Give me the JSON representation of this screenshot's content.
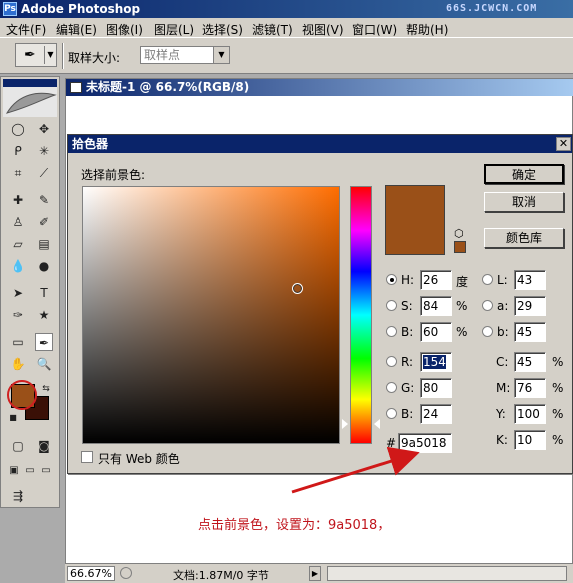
{
  "app": {
    "title": "Adobe Photoshop",
    "watermark": "66S.JCWCN.COM"
  },
  "menu": [
    "文件(F)",
    "编辑(E)",
    "图像(I)",
    "图层(L)",
    "选择(S)",
    "滤镜(T)",
    "视图(V)",
    "窗口(W)",
    "帮助(H)"
  ],
  "options": {
    "sample_label": "取样大小:",
    "sample_value": "取样点"
  },
  "document": {
    "title": "未标题-1 @ 66.7%(RGB/8)"
  },
  "status": {
    "zoom": "66.67%",
    "doc_info": "文档:1.87M/0 字节"
  },
  "picker": {
    "title": "拾色器",
    "select_label": "选择前景色:",
    "buttons": {
      "ok": "确定",
      "cancel": "取消",
      "library": "颜色库"
    },
    "hsb": [
      {
        "label": "H:",
        "value": "26",
        "unit": "度",
        "selected": true
      },
      {
        "label": "S:",
        "value": "84",
        "unit": "%",
        "selected": false
      },
      {
        "label": "B:",
        "value": "60",
        "unit": "%",
        "selected": false
      }
    ],
    "rgb": [
      {
        "label": "R:",
        "value": "154"
      },
      {
        "label": "G:",
        "value": "80"
      },
      {
        "label": "B:",
        "value": "24"
      }
    ],
    "lab": [
      {
        "label": "L:",
        "value": "43"
      },
      {
        "label": "a:",
        "value": "29"
      },
      {
        "label": "b:",
        "value": "45"
      }
    ],
    "cmyk": [
      {
        "label": "C:",
        "value": "45",
        "unit": "%"
      },
      {
        "label": "M:",
        "value": "76",
        "unit": "%"
      },
      {
        "label": "Y:",
        "value": "100",
        "unit": "%"
      },
      {
        "label": "K:",
        "value": "10",
        "unit": "%"
      }
    ],
    "hex_label": "#",
    "hex_value": "9a5018",
    "web_only_label": "只有 Web 颜色",
    "current_color": "#9a5018",
    "hue_color": "#ff6d00"
  },
  "annotation": "点击前景色，设置为：9a5018，",
  "colors": {
    "foreground": "#9a5018",
    "background": "#3a1006",
    "accent": "#c0141c"
  }
}
